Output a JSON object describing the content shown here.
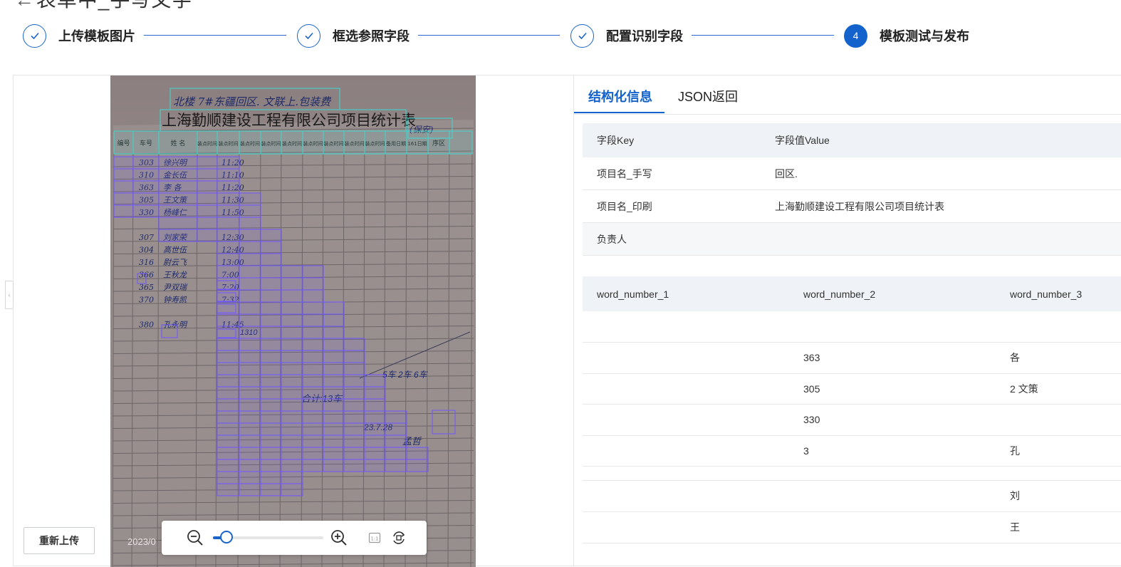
{
  "header": {
    "title_fragment": "表单中_手写文字",
    "back_arrow": "←"
  },
  "steps": [
    {
      "label": "上传模板图片",
      "status": "done"
    },
    {
      "label": "框选参照字段",
      "status": "done"
    },
    {
      "label": "配置识别字段",
      "status": "done"
    },
    {
      "label": "模板测试与发布",
      "status": "active",
      "number": "4"
    }
  ],
  "preview": {
    "reupload_label": "重新上传",
    "date_text": "2023/0",
    "doc_heading_handwritten": "北楼 7#东疆回区. 文联上.包装费",
    "doc_heading_printed": "上海勤顺建设工程有限公司项目统计表",
    "doc_heading_tag": "(保安)",
    "doc_columns": [
      "编号",
      "车号",
      "姓 名",
      "装点时间",
      "装点时间",
      "装点时间",
      "装点时间",
      "装点时间",
      "装点时间",
      "装点时间",
      "装点时间",
      "装点时间",
      "备用日期",
      "161日期",
      "序区"
    ],
    "doc_rows": [
      [
        "303",
        "徐兴明",
        "11:20"
      ],
      [
        "310",
        "金长伍",
        "11:10"
      ],
      [
        "363",
        "李 各",
        "11:20"
      ],
      [
        "305",
        "王文策",
        "11:30"
      ],
      [
        "330",
        "杨峰仁",
        "11:50"
      ],
      [
        "",
        "",
        ""
      ],
      [
        "307",
        "刘家荣",
        "12:30"
      ],
      [
        "304",
        "高世伍",
        "12:40"
      ],
      [
        "316",
        "尉云飞",
        "13:00"
      ],
      [
        "366",
        "王秋龙",
        "7:00"
      ],
      [
        "365",
        "尹双瑞",
        "7:20"
      ],
      [
        "370",
        "钟寿凯",
        "7:32"
      ],
      [
        "",
        "",
        ""
      ],
      [
        "380",
        "孔永明",
        "11:45"
      ]
    ],
    "doc_extra_1": "1310",
    "doc_extra_2": "5车 2车 6车",
    "doc_extra_3": "合计:13车",
    "doc_extra_4": "23.7.28",
    "doc_extra_5": "孟哲",
    "zoom": {
      "level_percent": 12
    }
  },
  "result": {
    "tabs": [
      {
        "label": "结构化信息",
        "active": true
      },
      {
        "label": "JSON返回",
        "active": false
      }
    ],
    "kv_headers": [
      "字段Key",
      "字段值Value"
    ],
    "kv_rows": [
      {
        "key": "项目名_手写",
        "value": "回区."
      },
      {
        "key": "项目名_印刷",
        "value": "上海勤顺建设工程有限公司项目统计表"
      },
      {
        "key": "负责人",
        "value": ""
      }
    ],
    "word_headers": [
      "word_number_1",
      "word_number_2",
      "word_number_3"
    ],
    "word_rows": [
      [
        "",
        "",
        ""
      ],
      [
        "",
        "363",
        "各"
      ],
      [
        "",
        "305",
        "2 文策"
      ],
      [
        "",
        "330",
        ""
      ],
      [
        "",
        "3",
        "孔"
      ],
      [
        "",
        "",
        ""
      ],
      [
        "",
        "",
        "刘"
      ],
      [
        "",
        "",
        "王"
      ]
    ]
  },
  "colors": {
    "accent": "#1463cc",
    "header_bg": "#eff2f6",
    "box_cyan": "#3fd9d0",
    "box_violet": "#6e55ff"
  }
}
